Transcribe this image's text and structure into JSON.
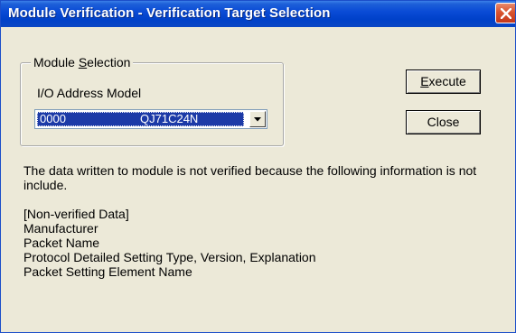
{
  "window": {
    "title": "Module Verification - Verification Target Selection",
    "title_color": "#0a46d6"
  },
  "group": {
    "legend_pre": "Module ",
    "legend_accel": "S",
    "legend_post": "election",
    "io_label": "I/O Address Model",
    "combo_address": "0000",
    "combo_model": "QJ71C24N"
  },
  "buttons": {
    "execute_accel": "E",
    "execute_rest": "xecute",
    "close": "Close"
  },
  "message": {
    "line1": "The data written to module is not verified because the following information is not",
    "line2": "include.",
    "items": [
      "[Non-verified Data]",
      "Manufacturer",
      "Packet Name",
      "Protocol Detailed Setting Type, Version, Explanation",
      "Packet Setting Element Name"
    ]
  },
  "icons": {
    "close": "close-icon",
    "dropdown": "chevron-down-icon"
  }
}
